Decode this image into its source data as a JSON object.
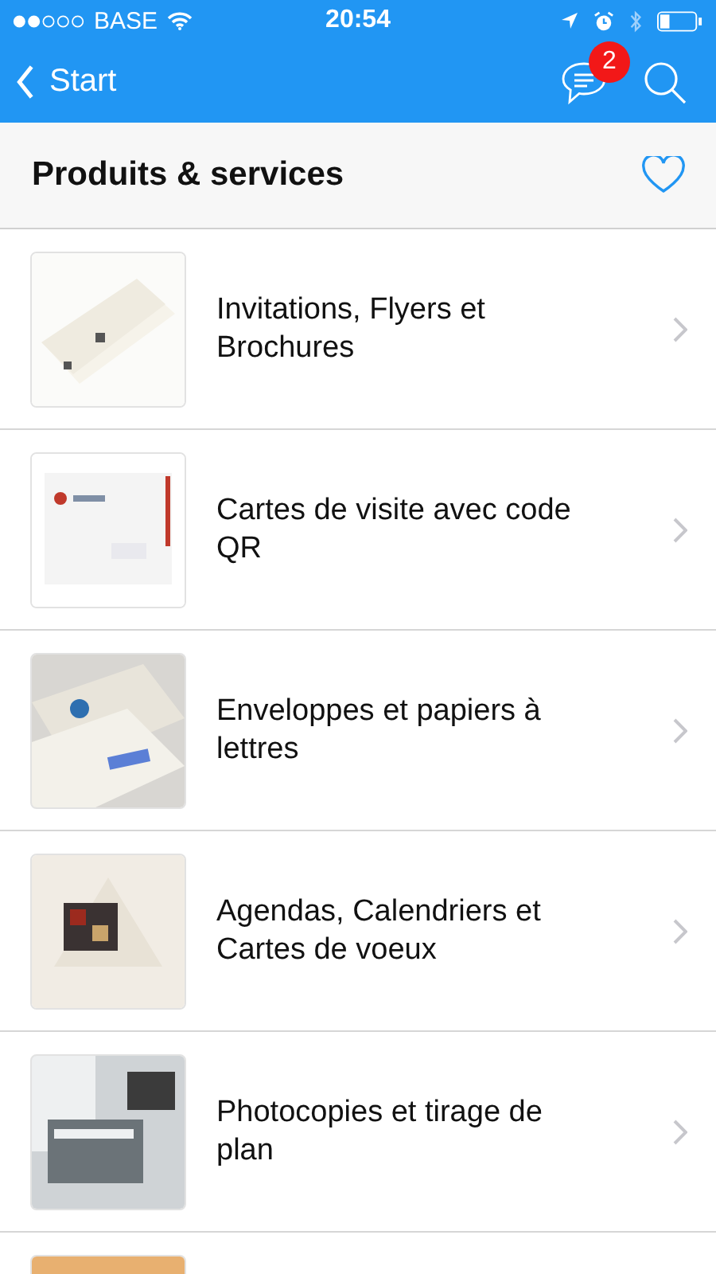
{
  "status_bar": {
    "carrier": "BASE",
    "time": "20:54"
  },
  "nav_bar": {
    "back_label": "Start",
    "notification_count": "2"
  },
  "section": {
    "title": "Produits & services"
  },
  "items": [
    {
      "kind": "product",
      "label": "Invitations, Flyers et Brochures"
    },
    {
      "kind": "product",
      "label": "Cartes de visite avec code QR"
    },
    {
      "kind": "product",
      "label": "Enveloppes et papiers à lettres"
    },
    {
      "kind": "product",
      "label": "Agendas, Calendriers et Cartes de voeux"
    },
    {
      "kind": "product",
      "label": "Photocopies et tirage de plan"
    },
    {
      "kind": "picture"
    }
  ]
}
